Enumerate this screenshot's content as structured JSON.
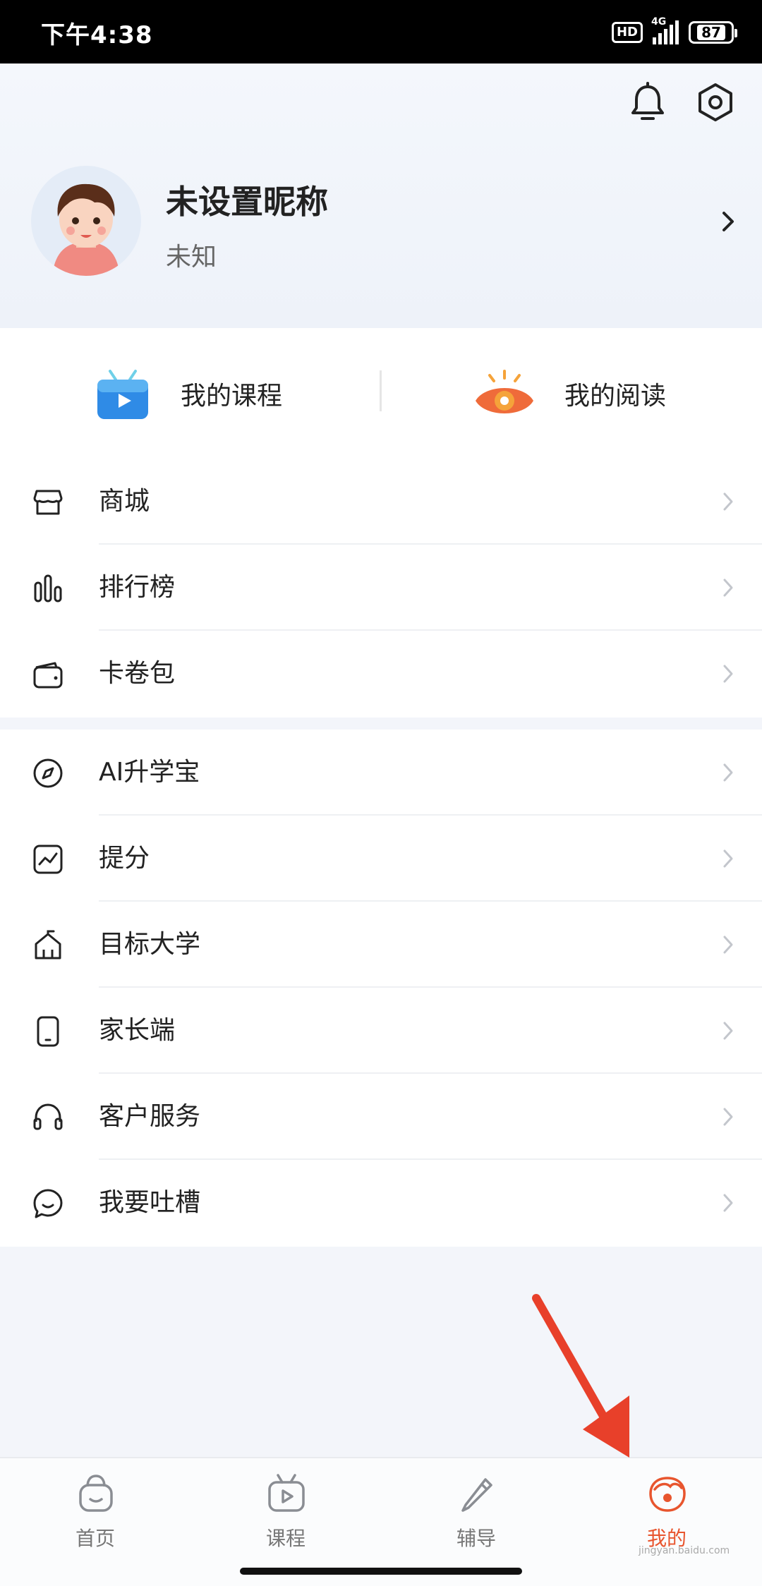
{
  "status_bar": {
    "time": "下午4:38",
    "hd": "HD",
    "network": "4G",
    "battery": "87"
  },
  "profile": {
    "name": "未设置昵称",
    "subtitle": "未知"
  },
  "quick_links": [
    {
      "label": "我的课程",
      "icon": "course-tv-icon"
    },
    {
      "label": "我的阅读",
      "icon": "reading-eye-icon"
    }
  ],
  "menu_group_1": [
    {
      "label": "商城",
      "icon": "store-icon"
    },
    {
      "label": "排行榜",
      "icon": "ranking-icon"
    },
    {
      "label": "卡卷包",
      "icon": "wallet-icon"
    }
  ],
  "menu_group_2": [
    {
      "label": "AI升学宝",
      "icon": "compass-icon"
    },
    {
      "label": "提分",
      "icon": "trend-chart-icon"
    },
    {
      "label": "目标大学",
      "icon": "university-icon"
    },
    {
      "label": "家长端",
      "icon": "phone-icon"
    },
    {
      "label": "客户服务",
      "icon": "headset-icon"
    },
    {
      "label": "我要吐槽",
      "icon": "chat-bubble-icon"
    }
  ],
  "bottom_nav": [
    {
      "label": "首页",
      "icon": "home-bag-icon",
      "active": false
    },
    {
      "label": "课程",
      "icon": "course-play-icon",
      "active": false
    },
    {
      "label": "辅导",
      "icon": "tutor-pencil-icon",
      "active": false
    },
    {
      "label": "我的",
      "icon": "profile-face-icon",
      "active": true
    }
  ],
  "colors": {
    "accent": "#e8552e",
    "annotation_arrow": "#e8402a"
  },
  "watermark": "jingyan.baidu.com"
}
